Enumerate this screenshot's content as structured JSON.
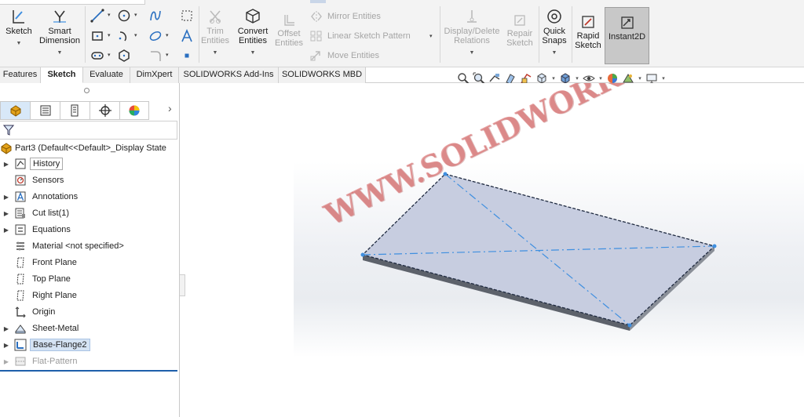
{
  "ribbon": {
    "sketch": "Sketch",
    "smart_dimension_1": "Smart",
    "smart_dimension_2": "Dimension",
    "trim_1": "Trim",
    "trim_2": "Entities",
    "convert_1": "Convert",
    "convert_2": "Entities",
    "offset_1": "Offset",
    "offset_2": "Entities",
    "mirror": "Mirror Entities",
    "linear_pattern": "Linear Sketch Pattern",
    "move": "Move Entities",
    "display_delete_1": "Display/Delete",
    "display_delete_2": "Relations",
    "repair_1": "Repair",
    "repair_2": "Sketch",
    "quick_snaps_1": "Quick",
    "quick_snaps_2": "Snaps",
    "rapid_1": "Rapid",
    "rapid_2": "Sketch",
    "instant2d": "Instant2D"
  },
  "tabs": [
    "Features",
    "Sketch",
    "Evaluate",
    "DimXpert",
    "SOLIDWORKS Add-Ins",
    "SOLIDWORKS MBD"
  ],
  "active_tab": "Sketch",
  "tree": {
    "root": "Part3  (Default<<Default>_Display State",
    "items": [
      {
        "label": "History",
        "icon": "history-icon"
      },
      {
        "label": "Sensors",
        "icon": "sensor-icon"
      },
      {
        "label": "Annotations",
        "icon": "annotation-icon"
      },
      {
        "label": "Cut list(1)",
        "icon": "cut-list-icon"
      },
      {
        "label": "Equations",
        "icon": "equation-icon"
      },
      {
        "label": "Material <not specified>",
        "icon": "material-icon"
      },
      {
        "label": "Front Plane",
        "icon": "plane-icon"
      },
      {
        "label": "Top Plane",
        "icon": "plane-icon"
      },
      {
        "label": "Right Plane",
        "icon": "plane-icon"
      },
      {
        "label": "Origin",
        "icon": "origin-icon"
      },
      {
        "label": "Sheet-Metal",
        "icon": "sheet-metal-icon"
      },
      {
        "label": "Base-Flange2",
        "icon": "base-flange-icon"
      },
      {
        "label": "Flat-Pattern",
        "icon": "flat-pattern-icon"
      }
    ]
  },
  "watermark": "WWW.SOLIDWORKSTUTORIALSFORBEGINNERS.COM",
  "colors": {
    "accent_blue": "#1e5faa",
    "sketch_blue": "#3f8fe0",
    "part_face": "#c7cde0",
    "watermark_red": "#d65a5a",
    "instant2d_bg": "#c8c8c8"
  }
}
